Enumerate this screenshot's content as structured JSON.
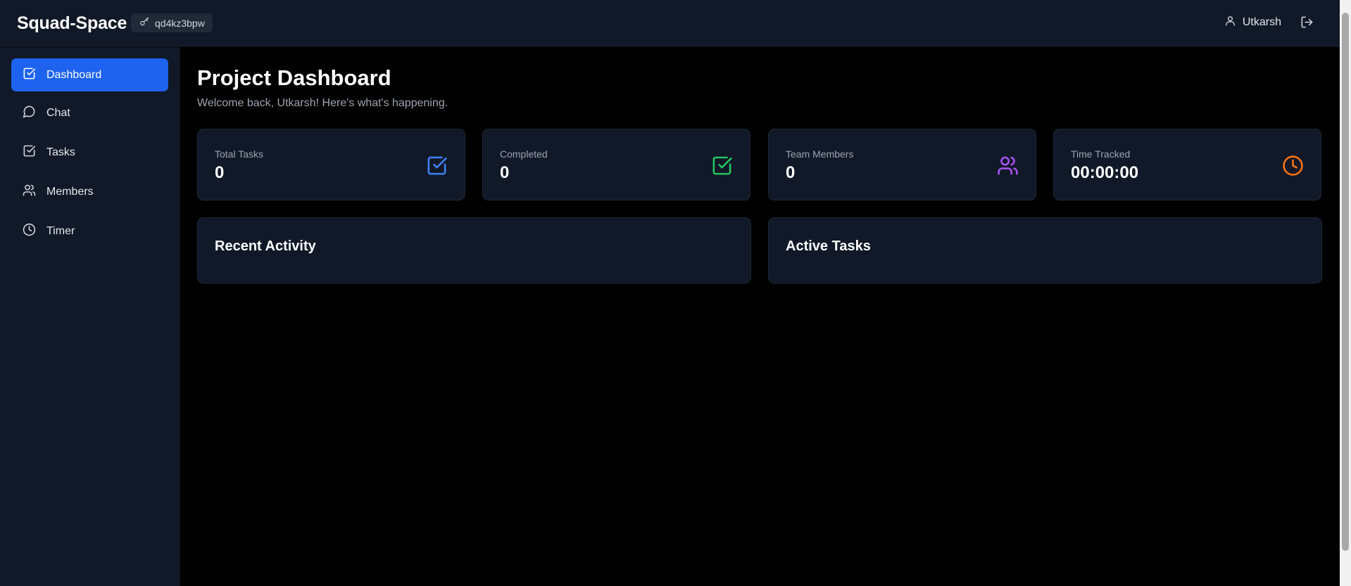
{
  "header": {
    "brand": "Squad-Space",
    "room_code": "qd4kz3bpw",
    "username": "Utkarsh"
  },
  "sidebar": {
    "items": [
      {
        "label": "Dashboard",
        "icon": "check-square-icon",
        "active": true
      },
      {
        "label": "Chat",
        "icon": "chat-bubble-icon",
        "active": false
      },
      {
        "label": "Tasks",
        "icon": "check-square-icon",
        "active": false
      },
      {
        "label": "Members",
        "icon": "users-icon",
        "active": false
      },
      {
        "label": "Timer",
        "icon": "clock-icon",
        "active": false
      }
    ]
  },
  "main": {
    "title": "Project Dashboard",
    "subtitle": "Welcome back, Utkarsh! Here's what's happening.",
    "stats": [
      {
        "label": "Total Tasks",
        "value": "0",
        "icon": "check-square-icon",
        "color": "#3b82f6"
      },
      {
        "label": "Completed",
        "value": "0",
        "icon": "check-square-icon",
        "color": "#22c55e"
      },
      {
        "label": "Team Members",
        "value": "0",
        "icon": "users-icon",
        "color": "#a855f7"
      },
      {
        "label": "Time Tracked",
        "value": "00:00:00",
        "icon": "clock-icon",
        "color": "#f97316"
      }
    ],
    "panels": [
      {
        "title": "Recent Activity"
      },
      {
        "title": "Active Tasks"
      }
    ]
  },
  "colors": {
    "accent": "#1d63f0",
    "surface": "#111827",
    "background": "#000000"
  }
}
